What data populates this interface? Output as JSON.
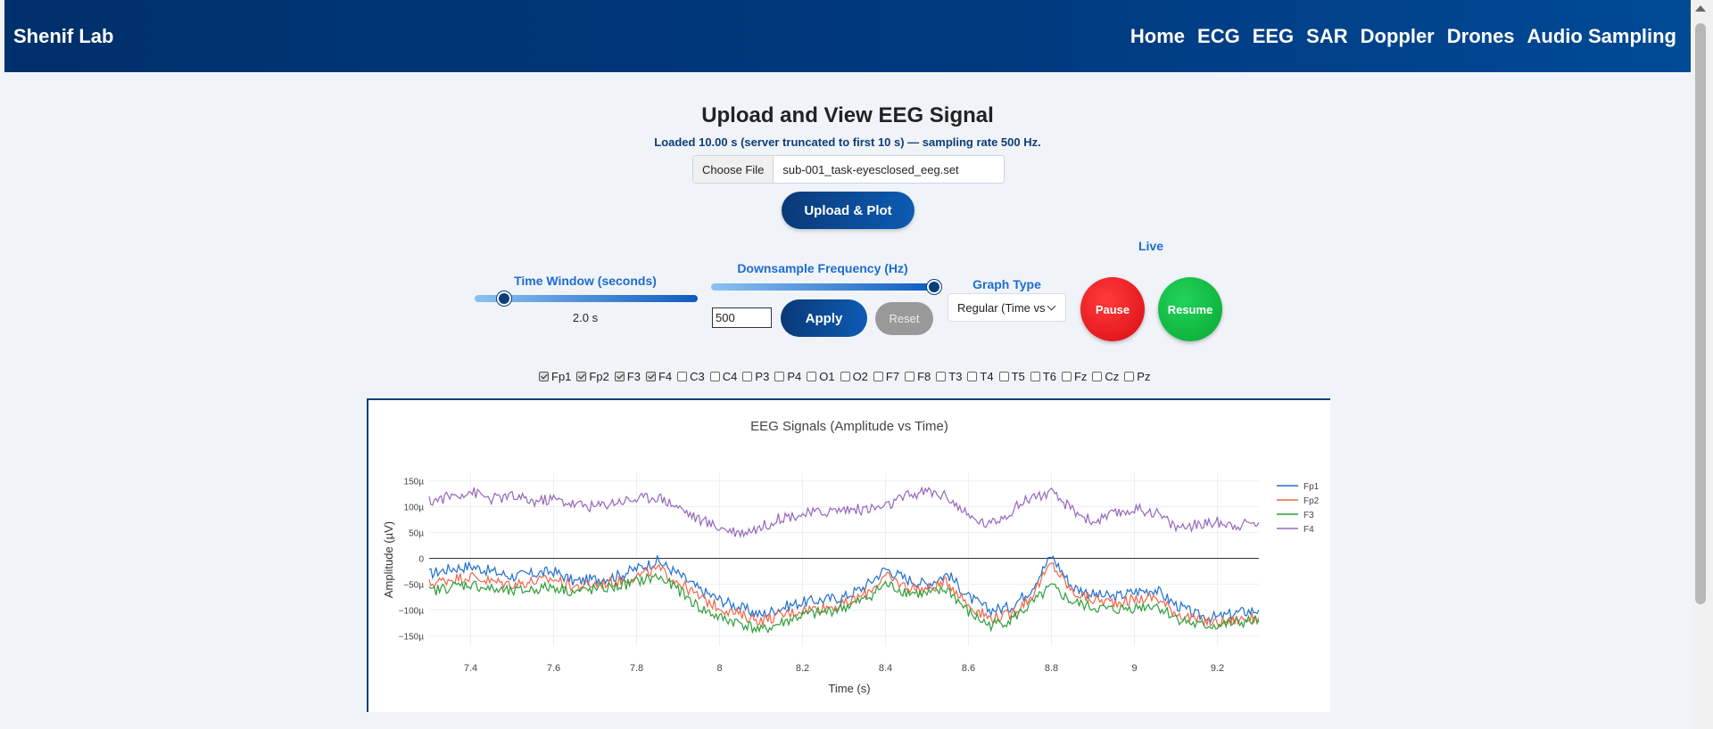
{
  "nav": {
    "brand": "Shenif Lab",
    "links": [
      "Home",
      "ECG",
      "EEG",
      "SAR",
      "Doppler",
      "Drones",
      "Audio Sampling"
    ]
  },
  "page": {
    "title": "Upload and View EEG Signal",
    "status": "Loaded 10.00 s (server truncated to first 10 s) — sampling rate 500 Hz.",
    "file_button": "Choose File",
    "file_name": "sub-001_task-eyesclosed_eeg.set",
    "upload_button": "Upload & Plot"
  },
  "controls": {
    "time_window_label": "Time Window (seconds)",
    "time_window_value": "2.0 s",
    "time_window_fraction": 0.13,
    "downsample_label": "Downsample Frequency (Hz)",
    "downsample_fraction": 1.0,
    "downsample_value": "500",
    "apply_label": "Apply",
    "reset_label": "Reset",
    "graph_type_label": "Graph Type",
    "graph_type_value": "Regular (Time vs",
    "live_label": "Live",
    "pause_label": "Pause",
    "resume_label": "Resume"
  },
  "channels": [
    {
      "name": "Fp1",
      "checked": true
    },
    {
      "name": "Fp2",
      "checked": true
    },
    {
      "name": "F3",
      "checked": true
    },
    {
      "name": "F4",
      "checked": true
    },
    {
      "name": "C3",
      "checked": false
    },
    {
      "name": "C4",
      "checked": false
    },
    {
      "name": "P3",
      "checked": false
    },
    {
      "name": "P4",
      "checked": false
    },
    {
      "name": "O1",
      "checked": false
    },
    {
      "name": "O2",
      "checked": false
    },
    {
      "name": "F7",
      "checked": false
    },
    {
      "name": "F8",
      "checked": false
    },
    {
      "name": "T3",
      "checked": false
    },
    {
      "name": "T4",
      "checked": false
    },
    {
      "name": "T5",
      "checked": false
    },
    {
      "name": "T6",
      "checked": false
    },
    {
      "name": "Fz",
      "checked": false
    },
    {
      "name": "Cz",
      "checked": false
    },
    {
      "name": "Pz",
      "checked": false
    }
  ],
  "colors": {
    "nav_bg": "#003a7f",
    "accent": "#1e6bd0",
    "pause": "#e0121b",
    "resume": "#0db13b"
  },
  "chart_data": {
    "type": "line",
    "title": "EEG Signals (Amplitude vs Time)",
    "xlabel": "Time (s)",
    "ylabel": "Amplitude (µV)",
    "xlim": [
      7.3,
      9.3
    ],
    "ylim": [
      -170,
      165
    ],
    "xticks": [
      7.4,
      7.6,
      7.8,
      8,
      8.2,
      8.4,
      8.6,
      8.8,
      9,
      9.2
    ],
    "xtick_labels": [
      "7.4",
      "7.6",
      "7.8",
      "8",
      "8.2",
      "8.4",
      "8.6",
      "8.8",
      "9",
      "9.2"
    ],
    "yticks": [
      150,
      100,
      50,
      0,
      -50,
      -100,
      -150
    ],
    "ytick_labels": [
      "150µ",
      "100µ",
      "50µ",
      "0",
      "−50µ",
      "−100µ",
      "−150µ"
    ],
    "legend_position": "top-right",
    "grid": true,
    "series": [
      {
        "name": "Fp1",
        "color": "#1f6fd1",
        "x": [
          7.3,
          7.35,
          7.4,
          7.45,
          7.5,
          7.55,
          7.6,
          7.65,
          7.7,
          7.75,
          7.8,
          7.85,
          7.9,
          7.95,
          8.0,
          8.05,
          8.1,
          8.15,
          8.2,
          8.25,
          8.3,
          8.35,
          8.4,
          8.45,
          8.5,
          8.55,
          8.6,
          8.65,
          8.7,
          8.75,
          8.8,
          8.85,
          8.9,
          8.95,
          9.0,
          9.05,
          9.1,
          9.15,
          9.2,
          9.25,
          9.3
        ],
        "y": [
          -30,
          -20,
          -15,
          -25,
          -35,
          -30,
          -25,
          -45,
          -40,
          -35,
          -20,
          -5,
          -30,
          -60,
          -80,
          -95,
          -110,
          -95,
          -85,
          -80,
          -75,
          -55,
          -20,
          -40,
          -50,
          -30,
          -75,
          -100,
          -95,
          -60,
          5,
          -55,
          -70,
          -75,
          -65,
          -60,
          -90,
          -110,
          -115,
          -105,
          -100
        ]
      },
      {
        "name": "Fp2",
        "color": "#f0664a",
        "x": [
          7.3,
          7.35,
          7.4,
          7.45,
          7.5,
          7.55,
          7.6,
          7.65,
          7.7,
          7.75,
          7.8,
          7.85,
          7.9,
          7.95,
          8.0,
          8.05,
          8.1,
          8.15,
          8.2,
          8.25,
          8.3,
          8.35,
          8.4,
          8.45,
          8.5,
          8.55,
          8.6,
          8.65,
          8.7,
          8.75,
          8.8,
          8.85,
          8.9,
          8.95,
          9.0,
          9.05,
          9.1,
          9.15,
          9.2,
          9.25,
          9.3
        ],
        "y": [
          -50,
          -40,
          -35,
          -45,
          -50,
          -45,
          -40,
          -55,
          -50,
          -45,
          -35,
          -20,
          -45,
          -75,
          -95,
          -110,
          -120,
          -110,
          -100,
          -95,
          -90,
          -70,
          -35,
          -55,
          -60,
          -45,
          -90,
          -115,
          -110,
          -75,
          -10,
          -65,
          -80,
          -85,
          -80,
          -75,
          -105,
          -120,
          -125,
          -118,
          -115
        ]
      },
      {
        "name": "F3",
        "color": "#2e9e38",
        "x": [
          7.3,
          7.35,
          7.4,
          7.45,
          7.5,
          7.55,
          7.6,
          7.65,
          7.7,
          7.75,
          7.8,
          7.85,
          7.9,
          7.95,
          8.0,
          8.05,
          8.1,
          8.15,
          8.2,
          8.25,
          8.3,
          8.35,
          8.4,
          8.45,
          8.5,
          8.55,
          8.6,
          8.65,
          8.7,
          8.75,
          8.8,
          8.85,
          8.9,
          8.95,
          9.0,
          9.05,
          9.1,
          9.15,
          9.2,
          9.25,
          9.3
        ],
        "y": [
          -65,
          -55,
          -50,
          -60,
          -65,
          -60,
          -55,
          -65,
          -60,
          -55,
          -45,
          -35,
          -60,
          -95,
          -115,
          -125,
          -140,
          -125,
          -110,
          -105,
          -95,
          -80,
          -50,
          -65,
          -70,
          -60,
          -105,
          -130,
          -120,
          -90,
          -55,
          -85,
          -95,
          -100,
          -95,
          -90,
          -115,
          -130,
          -130,
          -125,
          -120
        ]
      },
      {
        "name": "F4",
        "color": "#9467bd",
        "x": [
          7.3,
          7.35,
          7.4,
          7.45,
          7.5,
          7.55,
          7.6,
          7.65,
          7.7,
          7.75,
          7.8,
          7.85,
          7.9,
          7.95,
          8.0,
          8.05,
          8.1,
          8.15,
          8.2,
          8.25,
          8.3,
          8.35,
          8.4,
          8.45,
          8.5,
          8.55,
          8.6,
          8.65,
          8.7,
          8.75,
          8.8,
          8.85,
          8.9,
          8.95,
          9.0,
          9.05,
          9.1,
          9.15,
          9.2,
          9.25,
          9.3
        ],
        "y": [
          110,
          120,
          130,
          115,
          120,
          110,
          115,
          105,
          100,
          110,
          115,
          120,
          100,
          75,
          60,
          50,
          60,
          80,
          85,
          90,
          95,
          95,
          100,
          120,
          130,
          120,
          80,
          65,
          90,
          120,
          125,
          95,
          70,
          85,
          95,
          90,
          60,
          65,
          70,
          65,
          70
        ]
      }
    ]
  }
}
